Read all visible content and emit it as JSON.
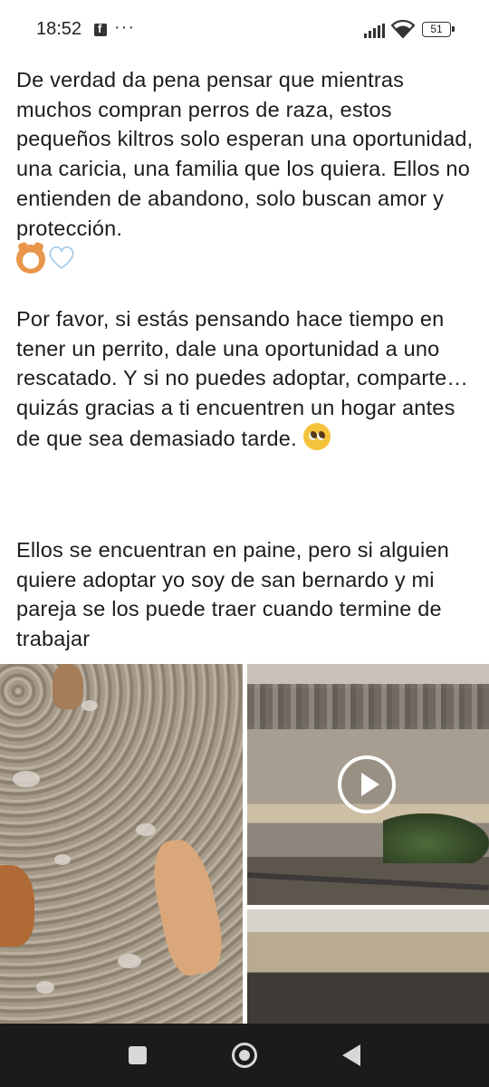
{
  "status_bar": {
    "time": "18:52",
    "notification_icons": [
      "facebook-icon",
      "more-dots-icon"
    ],
    "more_dots": "···",
    "battery_level": "51",
    "status_icons": [
      "signal-icon",
      "wifi-icon",
      "battery-icon"
    ]
  },
  "post": {
    "paragraph1": "De verdad da pena pensar que mientras muchos compran perros de raza, estos pequeños kiltros solo esperan una oportunidad, una caricia, una familia que los quiera. Ellos no entienden de abandono, solo buscan amor y protección.",
    "paragraph1_emojis": [
      "dog-face-emoji",
      "white-heart-emoji"
    ],
    "paragraph2": "Por favor, si estás pensando hace tiempo en tener un perrito, dale una oportunidad a uno rescatado. Y si no puedes adoptar, comparte… quizás gracias a ti encuentren un hogar antes de que sea demasiado tarde.",
    "paragraph2_emoji": "pleading-face-emoji",
    "paragraph3": "Ellos se encuentran en paine, pero si alguien quiere adoptar yo soy de san bernardo y mi pareja se los puede traer cuando termine de trabajar"
  },
  "media": {
    "items": [
      "photo-dogs-on-gravel",
      "video-dogs-in-field",
      "photo-field-distance"
    ],
    "video_has_play_button": true
  },
  "nav_bar": {
    "buttons": [
      "recents-button",
      "home-button",
      "back-button"
    ]
  }
}
